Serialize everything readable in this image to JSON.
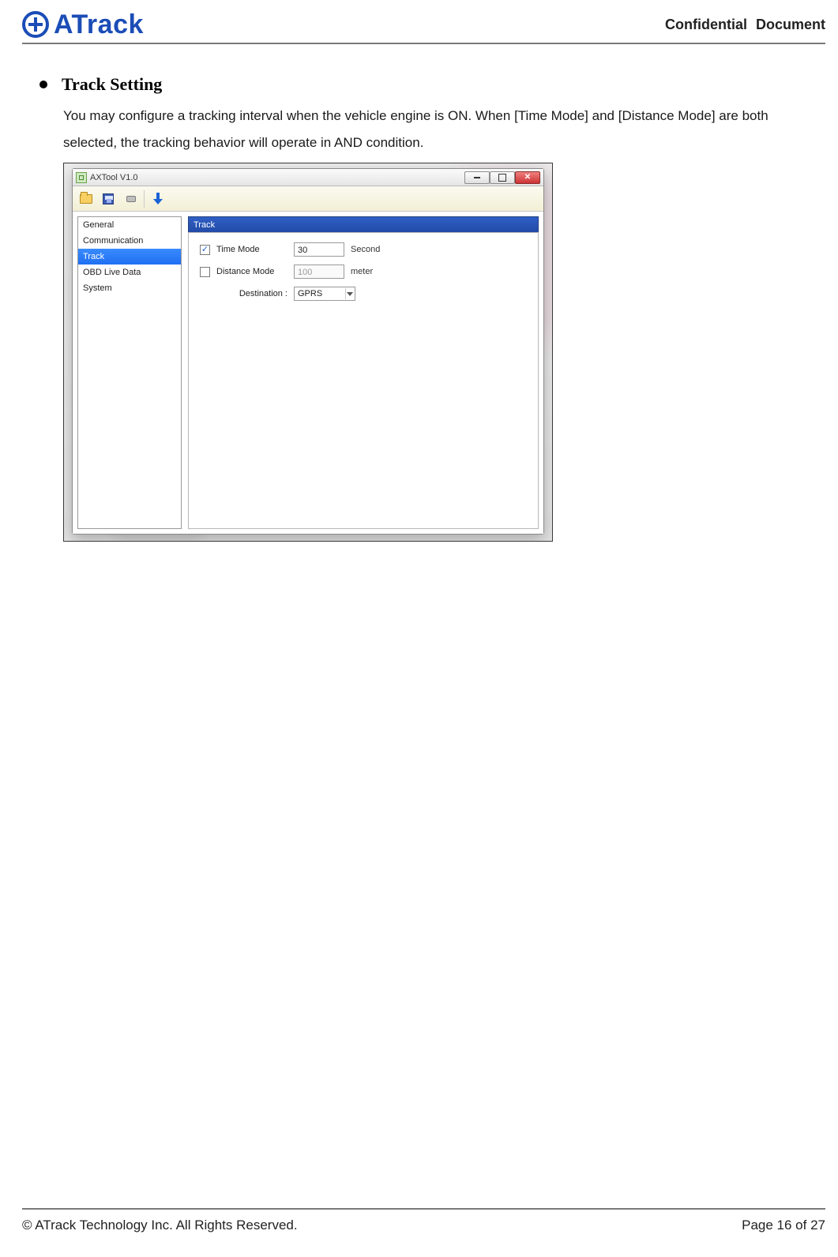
{
  "doc": {
    "brand": "ATrack",
    "confidential": "Confidential  Document",
    "copyright": "© ATrack Technology Inc. All Rights Reserved.",
    "page": "Page 16 of 27"
  },
  "section": {
    "title": "Track Setting",
    "body": "You may configure a tracking interval when the vehicle engine is ON. When [Time Mode] and [Distance Mode] are both selected, the tracking behavior will operate in AND condition."
  },
  "window": {
    "title": "AXTool V1.0",
    "sidebar": {
      "items": [
        {
          "label": "General"
        },
        {
          "label": "Communication"
        },
        {
          "label": "Track"
        },
        {
          "label": "OBD Live Data"
        },
        {
          "label": "System"
        }
      ],
      "selected_index": 2
    },
    "panel": {
      "title": "  Track",
      "time_mode": {
        "label": "Time Mode",
        "checked": true,
        "value": "30",
        "unit": "Second"
      },
      "distance_mode": {
        "label": "Distance Mode",
        "checked": false,
        "value": "100",
        "unit": "meter"
      },
      "destination": {
        "label": "Destination :",
        "value": "GPRS"
      }
    }
  }
}
